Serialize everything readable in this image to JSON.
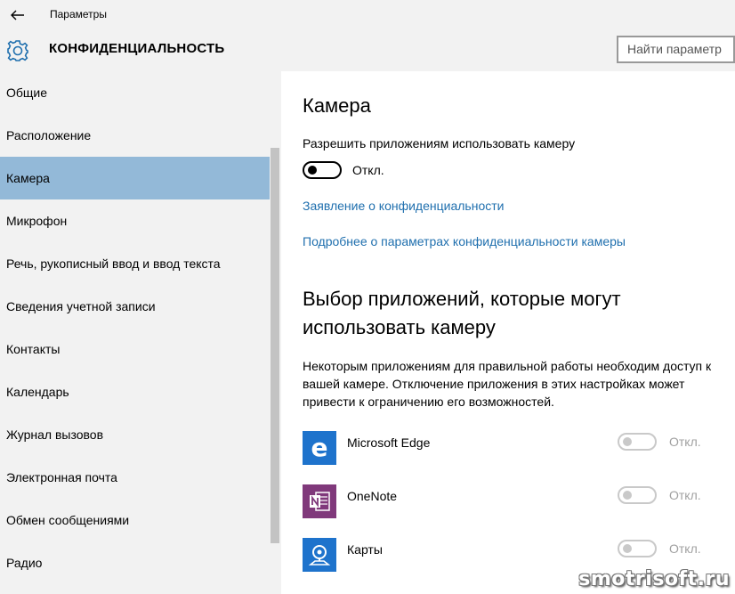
{
  "titlebar": {
    "title": "Параметры",
    "back_icon": "back-arrow-icon"
  },
  "header": {
    "section_title": "КОНФИДЕНЦИАЛЬНОСТЬ",
    "settings_icon": "gear-icon",
    "search_placeholder": "Найти параметр"
  },
  "sidebar": {
    "items": [
      {
        "label": "Общие",
        "active": false
      },
      {
        "label": "Расположение",
        "active": false
      },
      {
        "label": "Камера",
        "active": true
      },
      {
        "label": "Микрофон",
        "active": false
      },
      {
        "label": "Речь, рукописный ввод и ввод текста",
        "active": false
      },
      {
        "label": "Сведения учетной записи",
        "active": false
      },
      {
        "label": "Контакты",
        "active": false
      },
      {
        "label": "Календарь",
        "active": false
      },
      {
        "label": "Журнал вызовов",
        "active": false
      },
      {
        "label": "Электронная почта",
        "active": false
      },
      {
        "label": "Обмен сообщениями",
        "active": false
      },
      {
        "label": "Радио",
        "active": false
      }
    ],
    "active_color": "#93b9d8"
  },
  "main": {
    "title": "Камера",
    "allow_label": "Разрешить приложениям использовать камеру",
    "allow_state": "Откл.",
    "link_privacy_statement": "Заявление о конфиденциальности",
    "link_more_info": "Подробнее о параметрах конфиденциальности камеры",
    "choose_title": "Выбор приложений, которые могут использовать камеру",
    "description": "Некоторым приложениям для правильной работы необходим доступ к вашей камере. Отключение приложения в этих настройках может привести к ограничению его возможностей.",
    "apps": [
      {
        "name": "Microsoft Edge",
        "state": "Откл.",
        "icon": "edge-icon",
        "icon_color": "#1e73cc"
      },
      {
        "name": "OneNote",
        "state": "Откл.",
        "icon": "onenote-icon",
        "icon_color": "#80397b"
      },
      {
        "name": "Карты",
        "state": "Откл.",
        "icon": "maps-icon",
        "icon_color": "#1e73cc"
      }
    ],
    "link_color": "#1f6fae"
  },
  "watermark": "smotrisoft.ru"
}
